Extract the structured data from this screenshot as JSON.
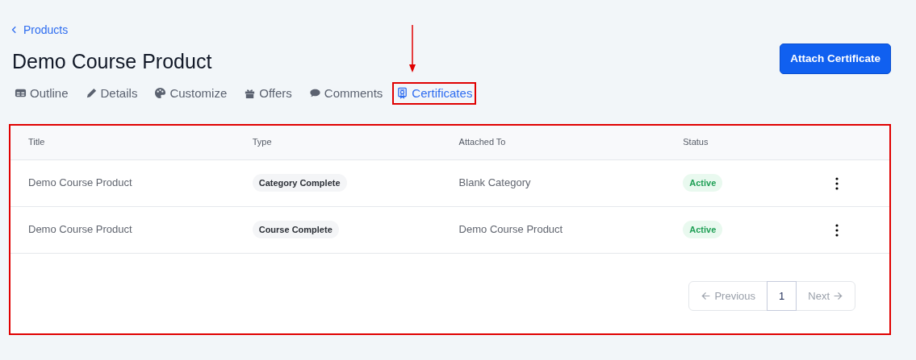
{
  "breadcrumb": {
    "label": "Products"
  },
  "title": "Demo Course Product",
  "primary_action": "Attach Certificate",
  "tabs": [
    {
      "label": "Outline",
      "selected": false
    },
    {
      "label": "Details",
      "selected": false
    },
    {
      "label": "Customize",
      "selected": false
    },
    {
      "label": "Offers",
      "selected": false
    },
    {
      "label": "Comments",
      "selected": false
    },
    {
      "label": "Certificates",
      "selected": true
    }
  ],
  "table": {
    "columns": [
      "Title",
      "Type",
      "Attached To",
      "Status"
    ],
    "rows": [
      {
        "title": "Demo Course Product",
        "type": "Category Complete",
        "attached_to": "Blank Category",
        "status": "Active"
      },
      {
        "title": "Demo Course Product",
        "type": "Course Complete",
        "attached_to": "Demo Course Product",
        "status": "Active"
      }
    ]
  },
  "pagination": {
    "previous": {
      "label": "Previous",
      "disabled": true
    },
    "pages": [
      {
        "label": "1",
        "selected": true
      }
    ],
    "next": {
      "label": "Next",
      "disabled": true
    }
  }
}
